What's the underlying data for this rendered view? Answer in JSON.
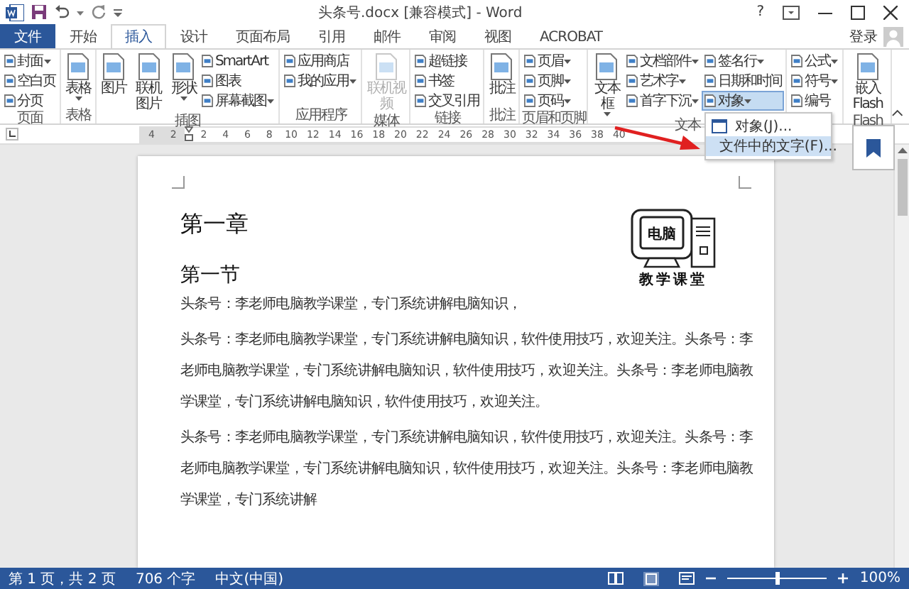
{
  "window": {
    "title": "头条号.docx [兼容模式] - Word",
    "help": "?"
  },
  "tabs": [
    {
      "label": "文件",
      "kind": "file",
      "selected": false
    },
    {
      "label": "开始",
      "kind": "tab",
      "selected": false
    },
    {
      "label": "插入",
      "kind": "tab",
      "selected": true
    },
    {
      "label": "设计",
      "kind": "tab",
      "selected": false
    },
    {
      "label": "页面布局",
      "kind": "tab",
      "selected": false
    },
    {
      "label": "引用",
      "kind": "tab",
      "selected": false
    },
    {
      "label": "邮件",
      "kind": "tab",
      "selected": false
    },
    {
      "label": "审阅",
      "kind": "tab",
      "selected": false
    },
    {
      "label": "视图",
      "kind": "tab",
      "selected": false
    },
    {
      "label": "ACROBAT",
      "kind": "tab",
      "selected": false
    }
  ],
  "account": {
    "label": "登录"
  },
  "ribbon": {
    "groups": [
      {
        "label": "页面",
        "columns": [
          [
            {
              "kind": "small",
              "label": "封面",
              "dropdown": true,
              "pressed": false,
              "disabled": false
            },
            {
              "kind": "small",
              "label": "空白页",
              "dropdown": false,
              "pressed": false,
              "disabled": false
            },
            {
              "kind": "small",
              "label": "分页",
              "dropdown": false,
              "pressed": false,
              "disabled": false
            }
          ]
        ]
      },
      {
        "label": "表格",
        "columns": [
          [
            {
              "kind": "large",
              "label": "表格",
              "dropdown": true,
              "pressed": false,
              "disabled": false
            }
          ]
        ]
      },
      {
        "label": "插图",
        "columns": [
          [
            {
              "kind": "large",
              "label": "图片",
              "dropdown": false,
              "pressed": false,
              "disabled": false
            }
          ],
          [
            {
              "kind": "large",
              "label": "联机图片",
              "dropdown": false,
              "pressed": false,
              "disabled": false
            }
          ],
          [
            {
              "kind": "large",
              "label": "形状",
              "dropdown": true,
              "pressed": false,
              "disabled": false
            }
          ],
          [
            {
              "kind": "small",
              "label": "SmartArt",
              "dropdown": false,
              "pressed": false,
              "disabled": false
            },
            {
              "kind": "small",
              "label": "图表",
              "dropdown": false,
              "pressed": false,
              "disabled": false
            },
            {
              "kind": "small",
              "label": "屏幕截图",
              "dropdown": true,
              "pressed": false,
              "disabled": false
            }
          ]
        ]
      },
      {
        "label": "应用程序",
        "columns": [
          [
            {
              "kind": "small",
              "label": "应用商店",
              "dropdown": false,
              "pressed": false,
              "disabled": false
            },
            {
              "kind": "small",
              "label": "我的应用",
              "dropdown": true,
              "pressed": false,
              "disabled": false
            }
          ]
        ]
      },
      {
        "label": "媒体",
        "columns": [
          [
            {
              "kind": "large",
              "label": "联机视频",
              "dropdown": false,
              "pressed": false,
              "disabled": true
            }
          ]
        ]
      },
      {
        "label": "链接",
        "columns": [
          [
            {
              "kind": "small",
              "label": "超链接",
              "dropdown": false,
              "pressed": false,
              "disabled": false
            },
            {
              "kind": "small",
              "label": "书签",
              "dropdown": false,
              "pressed": false,
              "disabled": false
            },
            {
              "kind": "small",
              "label": "交叉引用",
              "dropdown": false,
              "pressed": false,
              "disabled": false
            }
          ]
        ]
      },
      {
        "label": "批注",
        "columns": [
          [
            {
              "kind": "large",
              "label": "批注",
              "dropdown": false,
              "pressed": false,
              "disabled": false
            }
          ]
        ]
      },
      {
        "label": "页眉和页脚",
        "columns": [
          [
            {
              "kind": "small",
              "label": "页眉",
              "dropdown": true,
              "pressed": false,
              "disabled": false
            },
            {
              "kind": "small",
              "label": "页脚",
              "dropdown": true,
              "pressed": false,
              "disabled": false
            },
            {
              "kind": "small",
              "label": "页码",
              "dropdown": true,
              "pressed": false,
              "disabled": false
            }
          ]
        ]
      },
      {
        "label": "文本",
        "columns": [
          [
            {
              "kind": "large",
              "label": "文本框",
              "dropdown": true,
              "pressed": false,
              "disabled": false
            }
          ],
          [
            {
              "kind": "small",
              "label": "文档部件",
              "dropdown": true,
              "pressed": false,
              "disabled": false
            },
            {
              "kind": "small",
              "label": "艺术字",
              "dropdown": true,
              "pressed": false,
              "disabled": false
            },
            {
              "kind": "small",
              "label": "首字下沉",
              "dropdown": true,
              "pressed": false,
              "disabled": false
            }
          ],
          [
            {
              "kind": "small",
              "label": "签名行",
              "dropdown": true,
              "pressed": false,
              "disabled": false
            },
            {
              "kind": "small",
              "label": "日期和时间",
              "dropdown": false,
              "pressed": false,
              "disabled": false
            },
            {
              "kind": "small",
              "label": "对象",
              "dropdown": true,
              "pressed": true,
              "disabled": false
            }
          ]
        ]
      },
      {
        "columns": [
          [
            {
              "kind": "small",
              "label": "公式",
              "dropdown": true,
              "pressed": false,
              "disabled": false
            },
            {
              "kind": "small",
              "label": "符号",
              "dropdown": true,
              "pressed": false,
              "disabled": false
            },
            {
              "kind": "small",
              "label": "编号",
              "dropdown": false,
              "pressed": false,
              "disabled": false
            }
          ]
        ]
      },
      {
        "label": "Flash",
        "columns": [
          [
            {
              "kind": "large",
              "label": "嵌入 Flash",
              "dropdown": false,
              "pressed": false,
              "disabled": false
            }
          ]
        ]
      }
    ]
  },
  "object_menu": {
    "items": [
      {
        "label": "对象(J)...",
        "highlighted": false
      },
      {
        "label": "文件中的文字(F)...",
        "highlighted": true
      }
    ]
  },
  "ruler": {
    "left_ticks": [
      "4",
      "2"
    ],
    "right_ticks": [
      "2",
      "4",
      "6",
      "8",
      "10",
      "12",
      "14",
      "16",
      "18",
      "20",
      "22",
      "24",
      "26",
      "28",
      "30",
      "32",
      "34",
      "36",
      "38",
      "40"
    ]
  },
  "document": {
    "heading": "第一章",
    "subheading": "第一节",
    "logo": {
      "text": "电脑",
      "caption": "教学课堂"
    },
    "paragraphs": [
      "头条号：李老师电脑教学课堂，专门系统讲解电脑知识，",
      "头条号：李老师电脑教学课堂，专门系统讲解电脑知识，软件使用技巧，欢迎关注。头条号：李老师电脑教学课堂，专门系统讲解电脑知识，软件使用技巧，欢迎关注。头条号：李老师电脑教学课堂，专门系统讲解电脑知识，软件使用技巧，欢迎关注。",
      "头条号：李老师电脑教学课堂，专门系统讲解电脑知识，软件使用技巧，欢迎关注。头条号：李老师电脑教学课堂，专门系统讲解电脑知识，软件使用技巧，欢迎关注。头条号：李老师电脑教学课堂，专门系统讲解"
    ]
  },
  "status_bar": {
    "page": "第 1 页，共 2 页",
    "words": "706 个字",
    "language": "中文(中国)",
    "zoom": "100%",
    "zoom_slider": {
      "level": 0.5
    }
  }
}
